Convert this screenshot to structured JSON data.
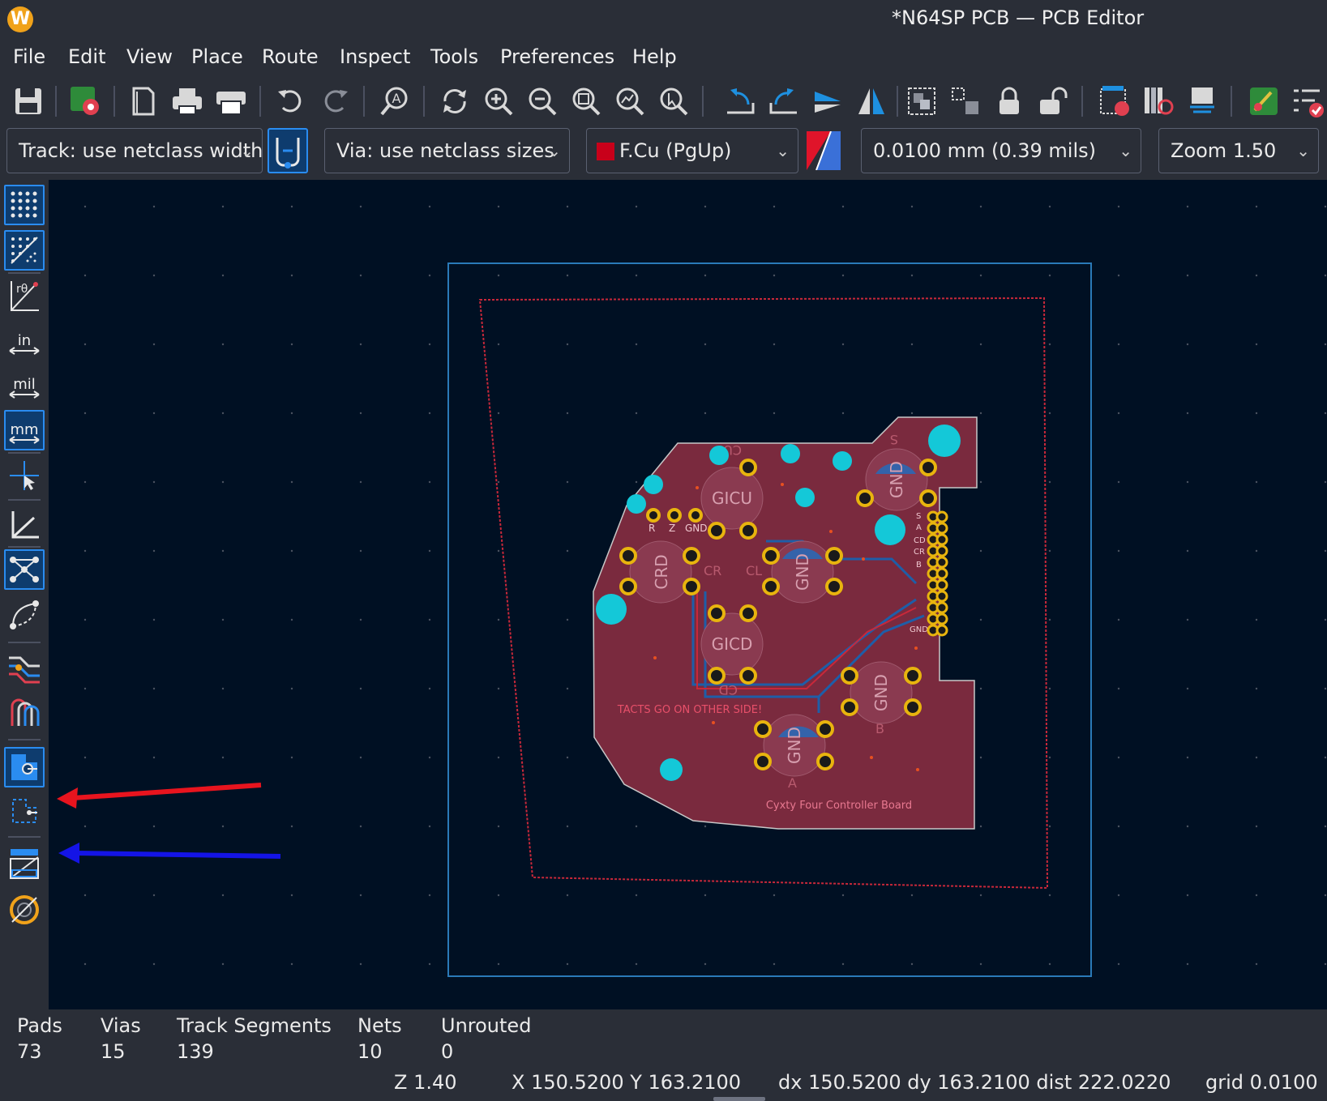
{
  "app": {
    "title": "*N64SP PCB — PCB Editor",
    "logo_letter": "W"
  },
  "menu": [
    "File",
    "Edit",
    "View",
    "Place",
    "Route",
    "Inspect",
    "Tools",
    "Preferences",
    "Help"
  ],
  "toolbar": {
    "icons": [
      "save-icon",
      "board-setup-icon",
      "page-settings-icon",
      "print-icon",
      "plot-icon",
      "undo-icon",
      "redo-icon",
      "find-icon",
      "redraw-icon",
      "zoom-in-icon",
      "zoom-out-icon",
      "zoom-fit-icon",
      "zoom-objects-icon",
      "zoom-selection-icon",
      "rotate-ccw-icon",
      "rotate-cw-icon",
      "flip-icon",
      "mirror-icon",
      "group-icon",
      "ungroup-icon",
      "lock-icon",
      "unlock-icon",
      "update-pcb-icon",
      "footprint-editor-icon",
      "footprint-browser-icon",
      "scripting-icon",
      "drc-icon"
    ]
  },
  "options": {
    "track": "Track: use netclass width",
    "via": "Via: use netclass sizes",
    "layer": "F.Cu (PgUp)",
    "layer_color": "#c8001a",
    "grid": "0.0100 mm (0.39 mils)",
    "zoom": "Zoom 1.50"
  },
  "left_toolbar": {
    "inch_label": "in",
    "mil_label": "mil",
    "mm_label": "mm",
    "polar_label": "rθ"
  },
  "board": {
    "silkscreen_note": "TACTS GO ON OTHER SIDE!",
    "board_title": "Cyxty Four Controller Board",
    "labels": [
      "GICU",
      "CRD",
      "GICD",
      "GND",
      "GND",
      "GND",
      "GND",
      "R",
      "Z",
      "GND",
      "CU",
      "CL",
      "CR",
      "CD",
      "A",
      "B",
      "S"
    ],
    "connector_labels": [
      "S",
      "A",
      "CD",
      "CR",
      "B",
      "GND"
    ]
  },
  "annotations": {
    "red_arrow_color": "#e8141e",
    "blue_arrow_color": "#1414e6"
  },
  "messages": [
    {
      "label": "Pads",
      "value": "73"
    },
    {
      "label": "Vias",
      "value": "15"
    },
    {
      "label": "Track Segments",
      "value": "139"
    },
    {
      "label": "Nets",
      "value": "10"
    },
    {
      "label": "Unrouted",
      "value": "0"
    }
  ],
  "status": {
    "z": "Z 1.40",
    "xy": "X 150.5200  Y 163.2100",
    "delta": "dx 150.5200  dy 163.2100  dist 222.0220",
    "grid": "grid 0.0100"
  }
}
